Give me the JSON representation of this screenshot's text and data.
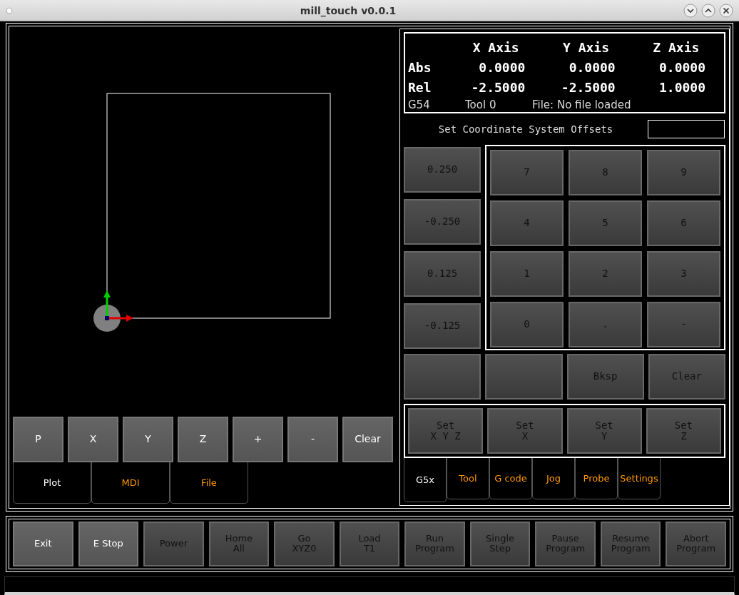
{
  "window": {
    "title": "mill_touch v0.0.1"
  },
  "plot_buttons": [
    {
      "label": "P",
      "disabled": false
    },
    {
      "label": "X",
      "disabled": false
    },
    {
      "label": "Y",
      "disabled": false
    },
    {
      "label": "Z",
      "disabled": false
    },
    {
      "label": "+",
      "disabled": false
    },
    {
      "label": "-",
      "disabled": false
    },
    {
      "label": "Clear",
      "disabled": false
    }
  ],
  "left_tabs": [
    {
      "label": "Plot",
      "selected": true
    },
    {
      "label": "MDI",
      "selected": false
    },
    {
      "label": "File",
      "selected": false
    }
  ],
  "dro": {
    "columns": [
      "X Axis",
      "Y Axis",
      "Z Axis"
    ],
    "rows": [
      {
        "label": "Abs",
        "values": [
          "0.0000",
          "0.0000",
          "0.0000"
        ]
      },
      {
        "label": "Rel",
        "values": [
          "-2.5000",
          "-2.5000",
          "1.0000"
        ]
      }
    ],
    "status": [
      "G54",
      "Tool 0",
      "File: No file loaded"
    ]
  },
  "offsets": {
    "title": "Set Coordinate System Offsets"
  },
  "jog_increments": [
    {
      "label": "0.250",
      "disabled": true
    },
    {
      "label": "-0.250",
      "disabled": true
    },
    {
      "label": "0.125",
      "disabled": true
    },
    {
      "label": "-0.125",
      "disabled": true
    }
  ],
  "keypad": [
    {
      "label": "7",
      "disabled": true
    },
    {
      "label": "8",
      "disabled": true
    },
    {
      "label": "9",
      "disabled": true
    },
    {
      "label": "4",
      "disabled": true
    },
    {
      "label": "5",
      "disabled": true
    },
    {
      "label": "6",
      "disabled": true
    },
    {
      "label": "1",
      "disabled": true
    },
    {
      "label": "2",
      "disabled": true
    },
    {
      "label": "3",
      "disabled": true
    },
    {
      "label": "0",
      "disabled": true
    },
    {
      "label": ".",
      "disabled": true
    },
    {
      "label": "-",
      "disabled": true
    }
  ],
  "edit_buttons": [
    {
      "kind": "blank",
      "disabled": true
    },
    {
      "kind": "blank",
      "disabled": true
    },
    {
      "kind": "key",
      "label": "Bksp",
      "disabled": true
    },
    {
      "kind": "key",
      "label": "Clear",
      "disabled": true
    }
  ],
  "set_buttons": [
    {
      "lines": [
        "Set",
        "X Y Z"
      ],
      "disabled": true
    },
    {
      "lines": [
        "Set",
        "X"
      ],
      "disabled": true
    },
    {
      "lines": [
        "Set",
        "Y"
      ],
      "disabled": true
    },
    {
      "lines": [
        "Set",
        "Z"
      ],
      "disabled": true
    }
  ],
  "right_tabs": [
    {
      "label": "G5x",
      "selected": true
    },
    {
      "label": "Tool",
      "selected": false
    },
    {
      "label": "G code",
      "selected": false
    },
    {
      "label": "Jog",
      "selected": false
    },
    {
      "label": "Probe",
      "selected": false
    },
    {
      "label": "Settings",
      "selected": false
    }
  ],
  "toolbar": [
    {
      "lines": [
        "Exit"
      ],
      "disabled": false
    },
    {
      "lines": [
        "E Stop"
      ],
      "disabled": false
    },
    {
      "lines": [
        "Power"
      ],
      "disabled": true
    },
    {
      "lines": [
        "Home",
        "All"
      ],
      "disabled": true
    },
    {
      "lines": [
        "Go",
        "XYZ0"
      ],
      "disabled": true
    },
    {
      "lines": [
        "Load",
        "T1"
      ],
      "disabled": true
    },
    {
      "lines": [
        "Run",
        "Program"
      ],
      "disabled": true
    },
    {
      "lines": [
        "Single",
        "Step"
      ],
      "disabled": true
    },
    {
      "lines": [
        "Pause",
        "Program"
      ],
      "disabled": true
    },
    {
      "lines": [
        "Resume",
        "Program"
      ],
      "disabled": true
    },
    {
      "lines": [
        "Abort",
        "Program"
      ],
      "disabled": true
    }
  ]
}
